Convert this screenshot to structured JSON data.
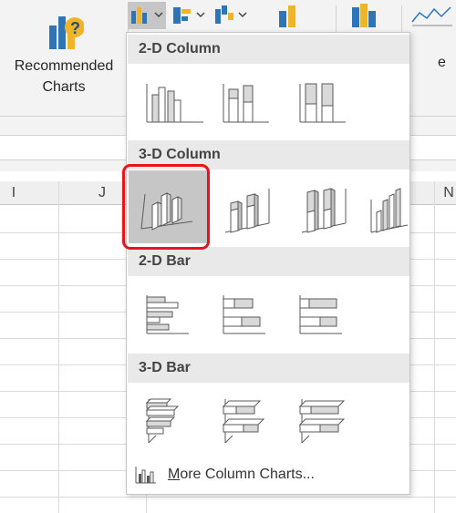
{
  "ribbon": {
    "recommended_charts": {
      "line1": "Recommended",
      "line2": "Charts",
      "icon": "recommended-charts-icon"
    },
    "right_partial_label": "e"
  },
  "grid": {
    "column_headers": [
      "I",
      "J",
      "N"
    ]
  },
  "dropdown": {
    "sections": [
      {
        "title": "2-D Column",
        "options": [
          "Clustered Column",
          "Stacked Column",
          "100% Stacked Column"
        ]
      },
      {
        "title": "3-D Column",
        "options": [
          "3-D Clustered Column",
          "3-D Stacked Column",
          "3-D 100% Stacked Column",
          "3-D Column"
        ]
      },
      {
        "title": "2-D Bar",
        "options": [
          "Clustered Bar",
          "Stacked Bar",
          "100% Stacked Bar"
        ]
      },
      {
        "title": "3-D Bar",
        "options": [
          "3-D Clustered Bar",
          "3-D Stacked Bar",
          "3-D 100% Stacked Bar"
        ]
      }
    ],
    "selected_option": "3-D Clustered Column",
    "highlight_color": "#e8141c",
    "more_link": {
      "prefix": "M",
      "rest": "ore Column Charts..."
    }
  }
}
